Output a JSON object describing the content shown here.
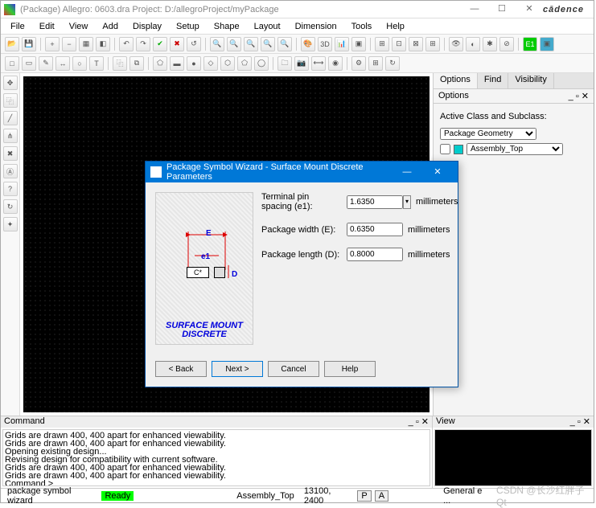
{
  "window": {
    "title": "(Package) Allegro: 0603.dra   Project: D:/allegroProject/myPackage",
    "brand": "cādence"
  },
  "menu": [
    "File",
    "Edit",
    "View",
    "Add",
    "Display",
    "Setup",
    "Shape",
    "Layout",
    "Dimension",
    "Tools",
    "Help"
  ],
  "rightpanel": {
    "tabs": [
      "Options",
      "Find",
      "Visibility"
    ],
    "title": "Options",
    "group_label": "Active Class and Subclass:",
    "class_value": "Package Geometry",
    "subclass_value": "Assembly_Top"
  },
  "command": {
    "title": "Command",
    "lines": [
      "Grids are drawn 400, 400 apart for enhanced viewability.",
      "Grids are drawn 400, 400 apart for enhanced viewability.",
      "Opening existing design...",
      "Revising design for compatibility with current software.",
      "Grids are drawn 400, 400 apart for enhanced viewability.",
      "Grids are drawn 400, 400 apart for enhanced viewability.",
      "Command >"
    ]
  },
  "view": {
    "title": "View"
  },
  "status": {
    "left": "package symbol wizard",
    "ready": "Ready",
    "subclass": "Assembly_Top",
    "coords": "13100, 2400",
    "p": "P",
    "a": "A",
    "right": "General e ...",
    "watermark": "CSDN @长沙红胖子Qt"
  },
  "dialog": {
    "title": "Package Symbol Wizard - Surface Mount Discrete Parameters",
    "diagram": {
      "E": "E",
      "e1": "e1",
      "D": "D",
      "C": "C*",
      "caption1": "SURFACE MOUNT",
      "caption2": "DISCRETE"
    },
    "fields": {
      "e1_label": "Terminal pin spacing (e1):",
      "e1_value": "1.6350",
      "E_label": "Package width (E):",
      "E_value": "0.6350",
      "D_label": "Package length (D):",
      "D_value": "0.8000",
      "unit": "millimeters"
    },
    "buttons": {
      "back": "< Back",
      "next": "Next >",
      "cancel": "Cancel",
      "help": "Help"
    }
  }
}
